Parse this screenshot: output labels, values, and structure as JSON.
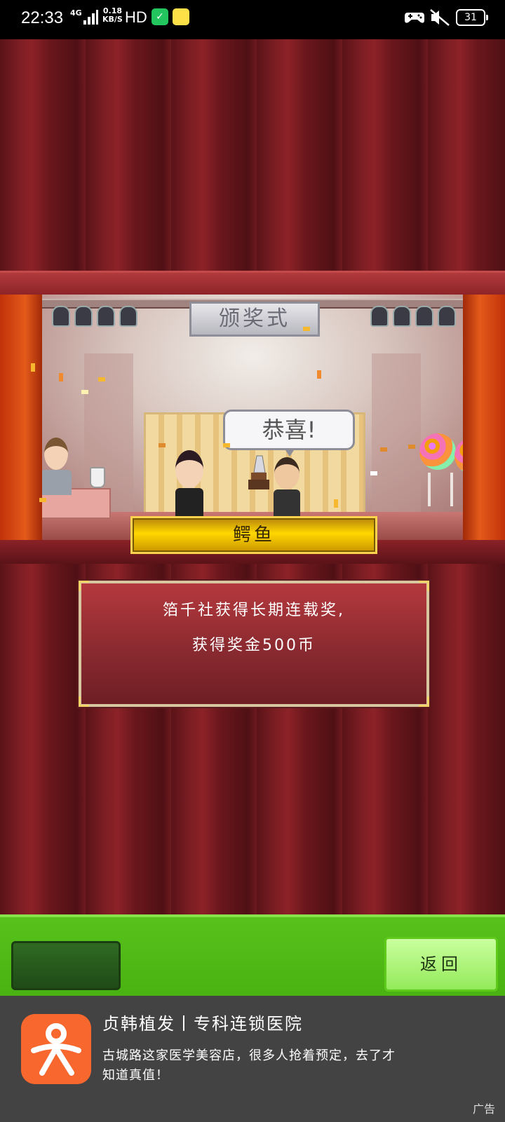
{
  "status_bar": {
    "time": "22:33",
    "network": "4G",
    "speed_value": "0.18",
    "speed_unit": "KB/S",
    "hd": "HD",
    "battery": "31"
  },
  "stage": {
    "sign": "颁奖式",
    "speech": "恭喜!",
    "award_name": "鳄鱼"
  },
  "award_message": {
    "line1": "箔千社获得长期连载奖,",
    "line2": "获得奖金500币"
  },
  "controls": {
    "return_label": "返回"
  },
  "ad": {
    "title": "贞韩植发丨专科连锁医院",
    "description": "古城路这家医学美容店，很多人抢着预定，去了才知道真值！",
    "label": "广告"
  },
  "colors": {
    "curtain": "#7a1d22",
    "gold": "#ffd700",
    "green_bar": "#58c21c",
    "ad_bg": "#434343",
    "ad_icon": "#f8672e"
  }
}
